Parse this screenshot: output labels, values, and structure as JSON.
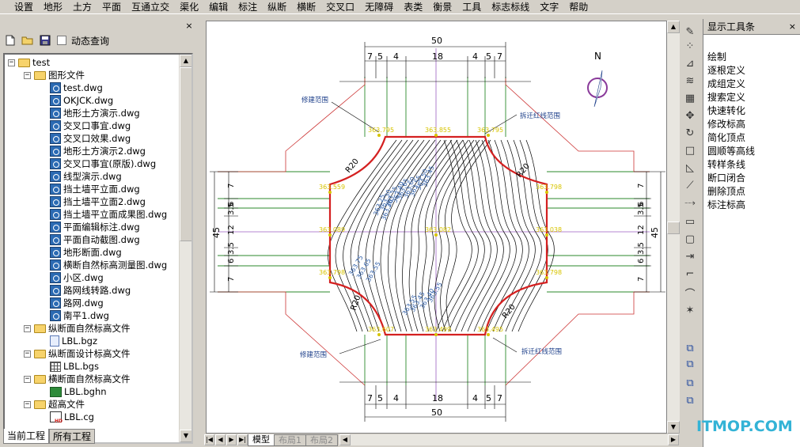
{
  "menu": [
    "设置",
    "地形",
    "土方",
    "平面",
    "互通立交",
    "渠化",
    "编辑",
    "标注",
    "纵断",
    "横断",
    "交叉口",
    "无障碍",
    "表类",
    "衡景",
    "工具",
    "标志标线",
    "文字",
    "帮助"
  ],
  "left_panel": {
    "close_glyph": "×",
    "dynamic_query_label": "动态查询",
    "tree": [
      {
        "label": "test",
        "level": 0,
        "icon": "folder",
        "expander": "−"
      },
      {
        "label": "图形文件",
        "level": 1,
        "icon": "folder",
        "expander": "−"
      },
      {
        "label": "test.dwg",
        "level": 2,
        "icon": "dwg"
      },
      {
        "label": "OKJCK.dwg",
        "level": 2,
        "icon": "dwg"
      },
      {
        "label": "地形土方演示.dwg",
        "level": 2,
        "icon": "dwg"
      },
      {
        "label": "交叉口事宜.dwg",
        "level": 2,
        "icon": "dwg"
      },
      {
        "label": "交叉口效果.dwg",
        "level": 2,
        "icon": "dwg"
      },
      {
        "label": "地形土方演示2.dwg",
        "level": 2,
        "icon": "dwg"
      },
      {
        "label": "交叉口事宜(原版).dwg",
        "level": 2,
        "icon": "dwg"
      },
      {
        "label": "线型演示.dwg",
        "level": 2,
        "icon": "dwg"
      },
      {
        "label": "挡土墙平立面.dwg",
        "level": 2,
        "icon": "dwg"
      },
      {
        "label": "挡土墙平立面2.dwg",
        "level": 2,
        "icon": "dwg"
      },
      {
        "label": "挡土墙平立面成果图.dwg",
        "level": 2,
        "icon": "dwg"
      },
      {
        "label": "平面编辑标注.dwg",
        "level": 2,
        "icon": "dwg"
      },
      {
        "label": "平面自动截图.dwg",
        "level": 2,
        "icon": "dwg"
      },
      {
        "label": "地形断面.dwg",
        "level": 2,
        "icon": "dwg"
      },
      {
        "label": "横断自然标高测量图.dwg",
        "level": 2,
        "icon": "dwg"
      },
      {
        "label": "小区.dwg",
        "level": 2,
        "icon": "dwg"
      },
      {
        "label": "路网线转路.dwg",
        "level": 2,
        "icon": "dwg"
      },
      {
        "label": "路网.dwg",
        "level": 2,
        "icon": "dwg"
      },
      {
        "label": "南平1.dwg",
        "level": 2,
        "icon": "dwg"
      },
      {
        "label": "纵断面自然标高文件",
        "level": 1,
        "icon": "folder",
        "expander": "−"
      },
      {
        "label": "LBL.bgz",
        "level": 2,
        "icon": "bgz"
      },
      {
        "label": "纵断面设计标高文件",
        "level": 1,
        "icon": "folder",
        "expander": "−"
      },
      {
        "label": "LBL.bgs",
        "level": 2,
        "icon": "bgs"
      },
      {
        "label": "横断面自然标高文件",
        "level": 1,
        "icon": "folder",
        "expander": "−"
      },
      {
        "label": "LBL.bghn",
        "level": 2,
        "icon": "bghn"
      },
      {
        "label": "超高文件",
        "level": 1,
        "icon": "folder",
        "expander": "−"
      },
      {
        "label": "LBL.cg",
        "level": 2,
        "icon": "cg"
      }
    ],
    "tabs": [
      "当前工程",
      "所有工程"
    ]
  },
  "drawing": {
    "top_total": "50",
    "top_dims": [
      "7",
      "5",
      "4",
      "18",
      "4",
      "5",
      "7"
    ],
    "bottom_total": "50",
    "bottom_dims": [
      "7",
      "5",
      "4",
      "18",
      "4",
      "5",
      "7"
    ],
    "left_total": "45",
    "left_dims": [
      "7",
      "6",
      "3.5",
      "12",
      "3.5",
      "6",
      "7"
    ],
    "right_total": "45",
    "right_dims": [
      "7",
      "6",
      "3.5",
      "12",
      "3.5",
      "6",
      "7"
    ],
    "north": "N",
    "radius_label": "R20",
    "labels": {
      "tl": "修建范围",
      "tr": "拆迁红线范围",
      "bl": "修建范围",
      "br": "拆迁红线范围"
    },
    "elevations": [
      "363.795",
      "363.855",
      "363.795",
      "363.559",
      "363.798",
      "363.089",
      "363.082",
      "363.038",
      "363.798",
      "363.798",
      "363.607",
      "363.499",
      "363.495"
    ],
    "contour_labels": [
      "363.65",
      "363.60",
      "363.55",
      "363.50",
      "363.45",
      "363.40",
      "363.35",
      "363.30",
      "363.25",
      "363.20",
      "363.75",
      "363.65",
      "363.55",
      "363.55",
      "363.45",
      "363.40",
      "363.55"
    ]
  },
  "layout_tabs": [
    "模型",
    "布局1",
    "布局2"
  ],
  "right_panel": {
    "title": "显示工具条",
    "close_glyph": "×",
    "commands": [
      "绘制",
      "逐根定义",
      "成组定义",
      "搜索定义",
      "快速转化",
      "修改标高",
      "简化顶点",
      "圆顺等高线",
      "转样条线",
      "断口闭合",
      "删除顶点",
      "标注标高"
    ]
  },
  "tool_icons": [
    "pencil-icon",
    "dot-grid-icon",
    "mirror-icon",
    "wave-icon",
    "grid-icon",
    "move-cross-icon",
    "rotate-icon",
    "square-icon",
    "triangle-icon",
    "slash-icon",
    "dash-slash-icon",
    "rect-icon",
    "rect-alt-icon",
    "arrows-in-icon",
    "corner-icon",
    "curve-icon",
    "sparkle-icon",
    "stack-icon",
    "stack-alt-icon",
    "stack-3-icon",
    "stack-4-icon"
  ],
  "watermark": "ITMOP.COM",
  "colors": {
    "boundary": "#d42020",
    "road_line": "#2b8a2b",
    "ramp_line": "#cc3333",
    "elevation_text": "#d7c400",
    "contour": "#000000",
    "contour_label": "#2e5ea8",
    "axis": "#9b5fc0",
    "watermark": "#33b3d6"
  }
}
